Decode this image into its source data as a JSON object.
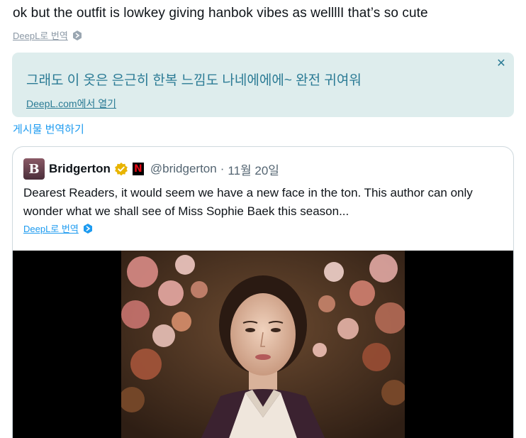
{
  "reply": {
    "text": "ok but the outfit is lowkey giving hanbok vibes as wellllI that’s so cute",
    "deepl_link": "DeepL로 번역"
  },
  "translation": {
    "text": "그래도 이 옷은 은근히 한복 느낌도 나네에에에~ 완전 귀여워",
    "open_link": "DeepL.com에서 열기",
    "close_icon": "close-icon"
  },
  "translate_post": "게시물 번역하기",
  "quote": {
    "avatar_letter": "B",
    "name": "Bridgerton",
    "handle": "@bridgerton",
    "dot": "·",
    "date": "11월 20일",
    "text": "Dearest Readers, it would seem we have a new face in the ton. This author can only wonder what we shall see of Miss Sophie Baek this season...",
    "deepl_link": "DeepL로 번역",
    "netflix_letter": "N"
  },
  "colors": {
    "accent": "#1d9bf0",
    "translation_bg": "#deeded",
    "translation_text": "#2b7b95",
    "verified_gold": "#e8b400"
  }
}
